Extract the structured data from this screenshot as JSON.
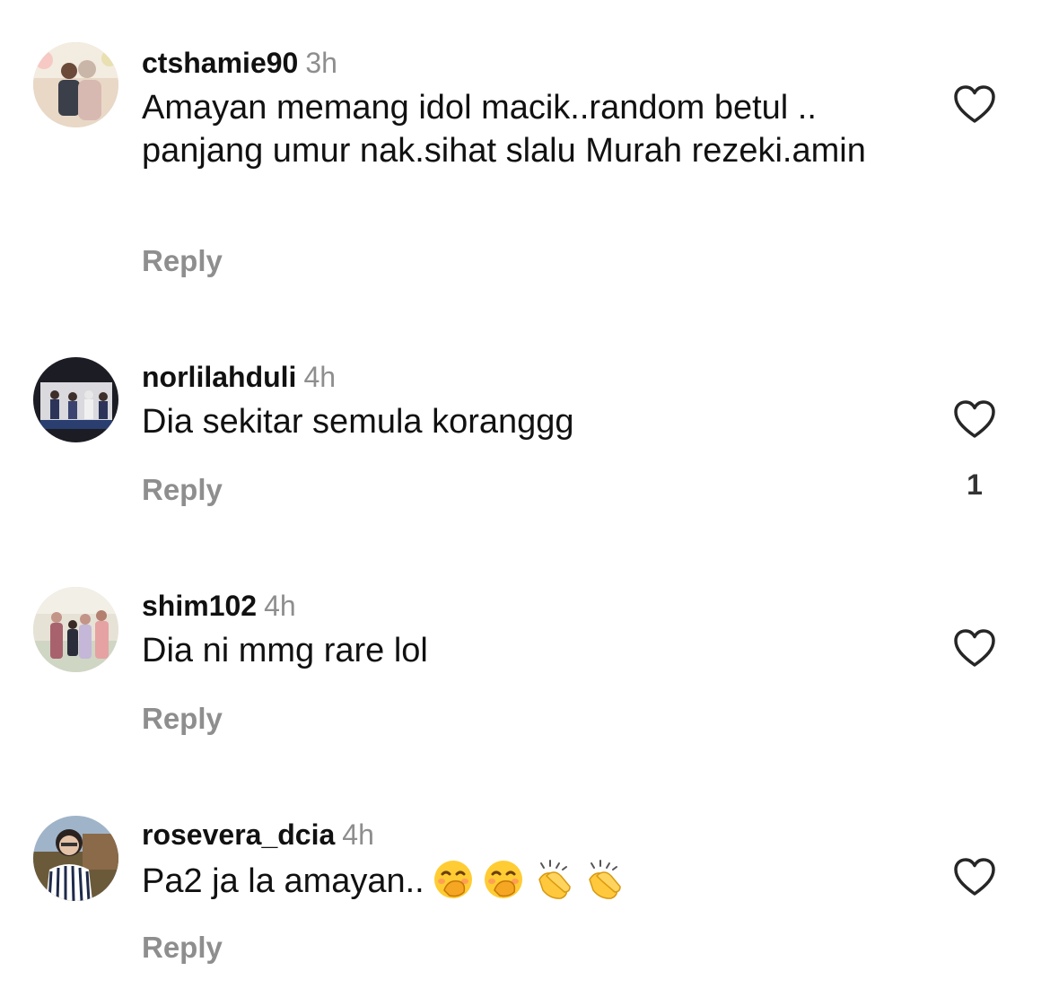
{
  "comments": [
    {
      "username": "ctshamie90",
      "time": "3h",
      "text": "Amayan memang idol macik..random betul .. panjang umur nak.sihat slalu Murah rezeki.amin",
      "reply_label": "Reply",
      "avatar": "avatar-couple-photo",
      "like_icon": "heart-outline-icon"
    },
    {
      "username": "norlilahduli",
      "time": "4h",
      "text": "Dia sekitar semula koranggg",
      "reply_label": "Reply",
      "like_count": "1",
      "avatar": "avatar-family-photo",
      "like_icon": "heart-outline-icon"
    },
    {
      "username": "shim102",
      "time": "4h",
      "text": "Dia ni mmg rare lol",
      "reply_label": "Reply",
      "avatar": "avatar-family-outdoor-photo",
      "like_icon": "heart-outline-icon"
    },
    {
      "username": "rosevera_dcia",
      "time": "4h",
      "text": "Pa2 ja la amayan..",
      "emojis": [
        "hand-over-mouth-emoji",
        "hand-over-mouth-emoji",
        "clapping-hands-emoji",
        "clapping-hands-emoji"
      ],
      "reply_label": "Reply",
      "avatar": "avatar-woman-photo",
      "like_icon": "heart-outline-icon"
    }
  ],
  "colors": {
    "text": "#111111",
    "secondary": "#8e8e8e",
    "background": "#ffffff"
  }
}
